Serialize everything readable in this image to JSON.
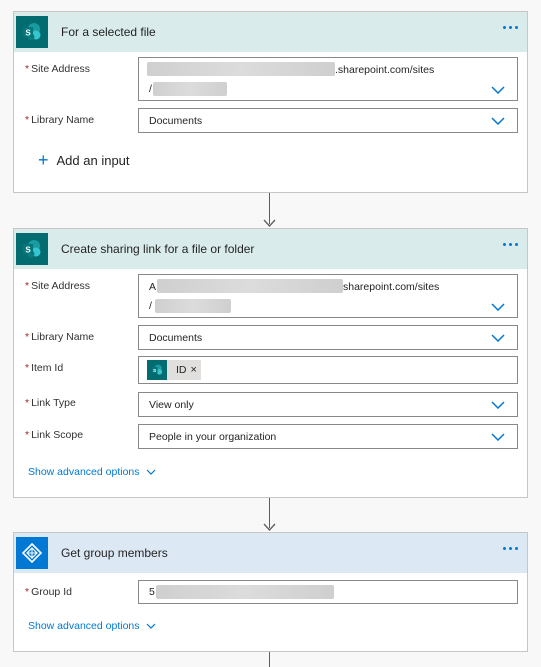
{
  "card1": {
    "title": "For a selected file",
    "site_label": "Site Address",
    "site_value_suffix": ".sharepoint.com/sites",
    "site_value_line2": "/",
    "library_label": "Library Name",
    "library_value": "Documents",
    "add_input": "Add an input"
  },
  "card2": {
    "title": "Create sharing link for a file or folder",
    "site_label": "Site Address",
    "site_value_prefix": "A",
    "site_value_suffix": "sharepoint.com/sites",
    "site_value_line2": "/",
    "library_label": "Library Name",
    "library_value": "Documents",
    "item_label": "Item Id",
    "item_token": "ID",
    "item_token_remove": "×",
    "link_type_label": "Link Type",
    "link_type_value": "View only",
    "link_scope_label": "Link Scope",
    "link_scope_value": "People in your organization",
    "advanced": "Show advanced options"
  },
  "card3": {
    "title": "Get group members",
    "group_label": "Group Id",
    "group_value_prefix": "5",
    "advanced": "Show advanced options"
  },
  "required_mark": "*",
  "colors": {
    "sharepoint": "#036c70",
    "azure_ad": "#0078d4",
    "accent": "#0078d4",
    "required": "#a4262c"
  }
}
